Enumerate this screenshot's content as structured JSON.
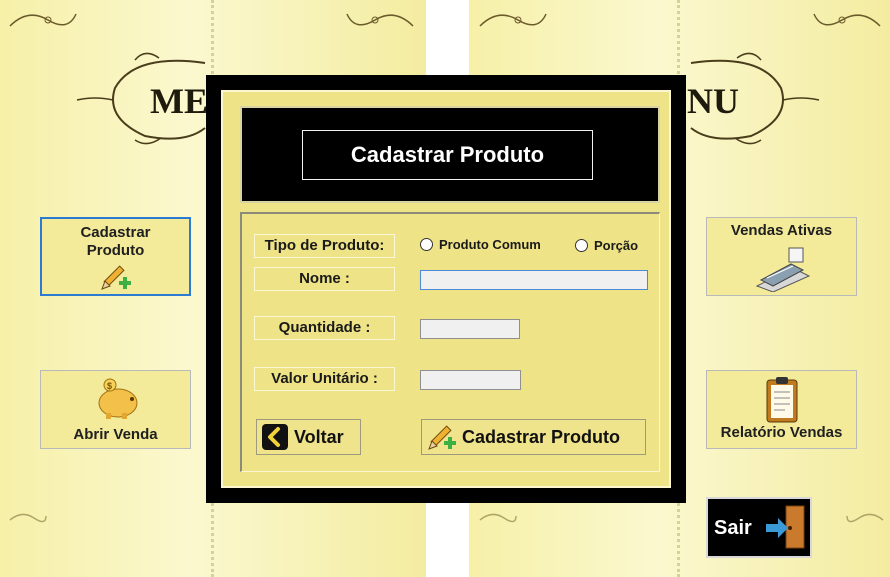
{
  "menu": {
    "title_left": "ME",
    "title_right": "NU",
    "buttons": [
      {
        "label_line1": "Cadastrar",
        "label_line2": "Produto",
        "icon": "pencil-plus-icon"
      },
      {
        "label": "Abrir Venda",
        "icon": "piggy-bank-icon"
      },
      {
        "label": "Vendas Ativas",
        "icon": "cash-register-icon"
      },
      {
        "label": "Relatório Vendas",
        "icon": "clipboard-icon"
      }
    ],
    "exit": {
      "label": "Sair",
      "icon": "exit-door-icon"
    }
  },
  "dialog": {
    "title": "Cadastrar Produto",
    "fields": {
      "tipo_label": "Tipo de Produto:",
      "radio_comum": "Produto Comum",
      "radio_porcao": "Porção",
      "nome_label": "Nome :",
      "nome_value": "",
      "quantidade_label": "Quantidade :",
      "quantidade_value": "",
      "valor_label": "Valor Unitário :",
      "valor_value": ""
    },
    "buttons": {
      "voltar": "Voltar",
      "cadastrar": "Cadastrar Produto"
    }
  },
  "colors": {
    "page_bg": "#f6f0a8",
    "dialog_bg": "#efe387",
    "frame": "#000000",
    "selected_border": "#2b7bd2"
  }
}
